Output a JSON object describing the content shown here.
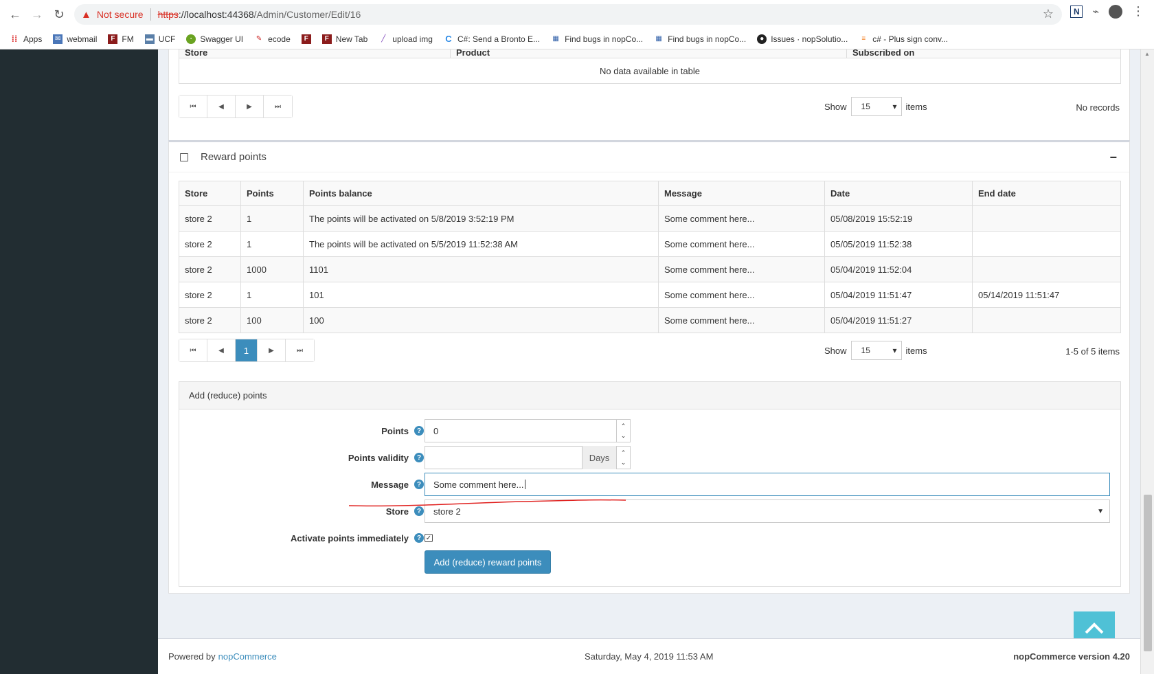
{
  "browser": {
    "not_secure": "Not secure",
    "url_scheme": "https",
    "url_host": "://localhost:44368",
    "url_path": "/Admin/Customer/Edit/16"
  },
  "bookmarks": [
    {
      "label": "Apps",
      "icon": "apps-icon"
    },
    {
      "label": "webmail",
      "icon": "mail-icon"
    },
    {
      "label": "FM",
      "icon": "fm-icon"
    },
    {
      "label": "UCF",
      "icon": "ucf-icon"
    },
    {
      "label": "Swagger UI",
      "icon": "swagger-icon"
    },
    {
      "label": "ecode",
      "icon": "ecode-icon"
    },
    {
      "label": "",
      "icon": "fm-icon"
    },
    {
      "label": "New Tab",
      "icon": "fm-icon"
    },
    {
      "label": "upload img",
      "icon": "upload-icon"
    },
    {
      "label": "C#: Send a Bronto E...",
      "icon": "c-icon"
    },
    {
      "label": "Find bugs in nopCo...",
      "icon": "grid-icon"
    },
    {
      "label": "Find bugs in nopCo...",
      "icon": "grid-icon"
    },
    {
      "label": "Issues · nopSolutio...",
      "icon": "github-icon"
    },
    {
      "label": "c# - Plus sign conv...",
      "icon": "stackoverflow-icon"
    }
  ],
  "subscriptions": {
    "headers": [
      "Store",
      "Product",
      "Subscribed on"
    ],
    "empty_text": "No data available in table",
    "show_label": "Show",
    "page_size": "15",
    "items_label": "items",
    "records_text": "No records"
  },
  "reward": {
    "title": "Reward points",
    "collapse_symbol": "−",
    "headers": [
      "Store",
      "Points",
      "Points balance",
      "Message",
      "Date",
      "End date"
    ],
    "rows": [
      [
        "store 2",
        "1",
        "The points will be activated on 5/8/2019 3:52:19 PM",
        "Some comment here...",
        "05/08/2019 15:52:19",
        ""
      ],
      [
        "store 2",
        "1",
        "The points will be activated on 5/5/2019 11:52:38 AM",
        "Some comment here...",
        "05/05/2019 11:52:38",
        ""
      ],
      [
        "store 2",
        "1000",
        "1101",
        "Some comment here...",
        "05/04/2019 11:52:04",
        ""
      ],
      [
        "store 2",
        "1",
        "101",
        "Some comment here...",
        "05/04/2019 11:51:47",
        "05/14/2019 11:51:47"
      ],
      [
        "store 2",
        "100",
        "100",
        "Some comment here...",
        "05/04/2019 11:51:27",
        ""
      ]
    ],
    "current_page": "1",
    "show_label": "Show",
    "page_size": "15",
    "items_label": "items",
    "records_text": "1-5 of 5 items"
  },
  "add_points": {
    "title": "Add (reduce) points",
    "points_label": "Points",
    "points_value": "0",
    "validity_label": "Points validity",
    "validity_value": "",
    "days_addon": "Days",
    "message_label": "Message",
    "message_value": "Some comment here...",
    "store_label": "Store",
    "store_value": "store 2",
    "activate_label": "Activate points immediately",
    "activate_checked": true,
    "submit_label": "Add (reduce) reward points"
  },
  "footer": {
    "powered_by": "Powered by",
    "brand_link": "nopCommerce",
    "datetime": "Saturday, May 4, 2019 11:53 AM",
    "version": "nopCommerce version 4.20"
  },
  "colors": {
    "primary": "#3c8dbc",
    "sidebar": "#222d32",
    "back_to_top": "#4fc1d6",
    "annotation_red": "#e0201e"
  }
}
